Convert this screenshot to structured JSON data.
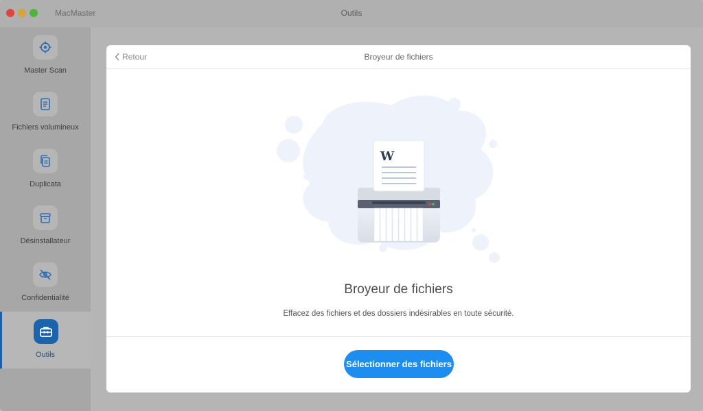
{
  "window": {
    "app_name": "MacMaster",
    "title": "Outils"
  },
  "sidebar": {
    "items": [
      {
        "label": "Master Scan",
        "icon": "target-icon",
        "active": false
      },
      {
        "label": "Fichiers volumineux",
        "icon": "document-icon",
        "active": false
      },
      {
        "label": "Duplicata",
        "icon": "copy-icon",
        "active": false
      },
      {
        "label": "Désinstallateur",
        "icon": "box-icon",
        "active": false
      },
      {
        "label": "Confidentialité",
        "icon": "eye-slash-icon",
        "active": false
      },
      {
        "label": "Outils",
        "icon": "toolbox-icon",
        "active": true
      }
    ]
  },
  "card": {
    "back_label": "Retour",
    "title": "Broyeur de fichiers",
    "feature_title": "Broyeur de fichiers",
    "feature_desc": "Effacez des fichiers et des dossiers indésirables en toute sécurité.",
    "primary_button": "Sélectionner des fichiers"
  },
  "colors": {
    "accent": "#1d8ef0",
    "active_nav": "#1c63ad"
  }
}
